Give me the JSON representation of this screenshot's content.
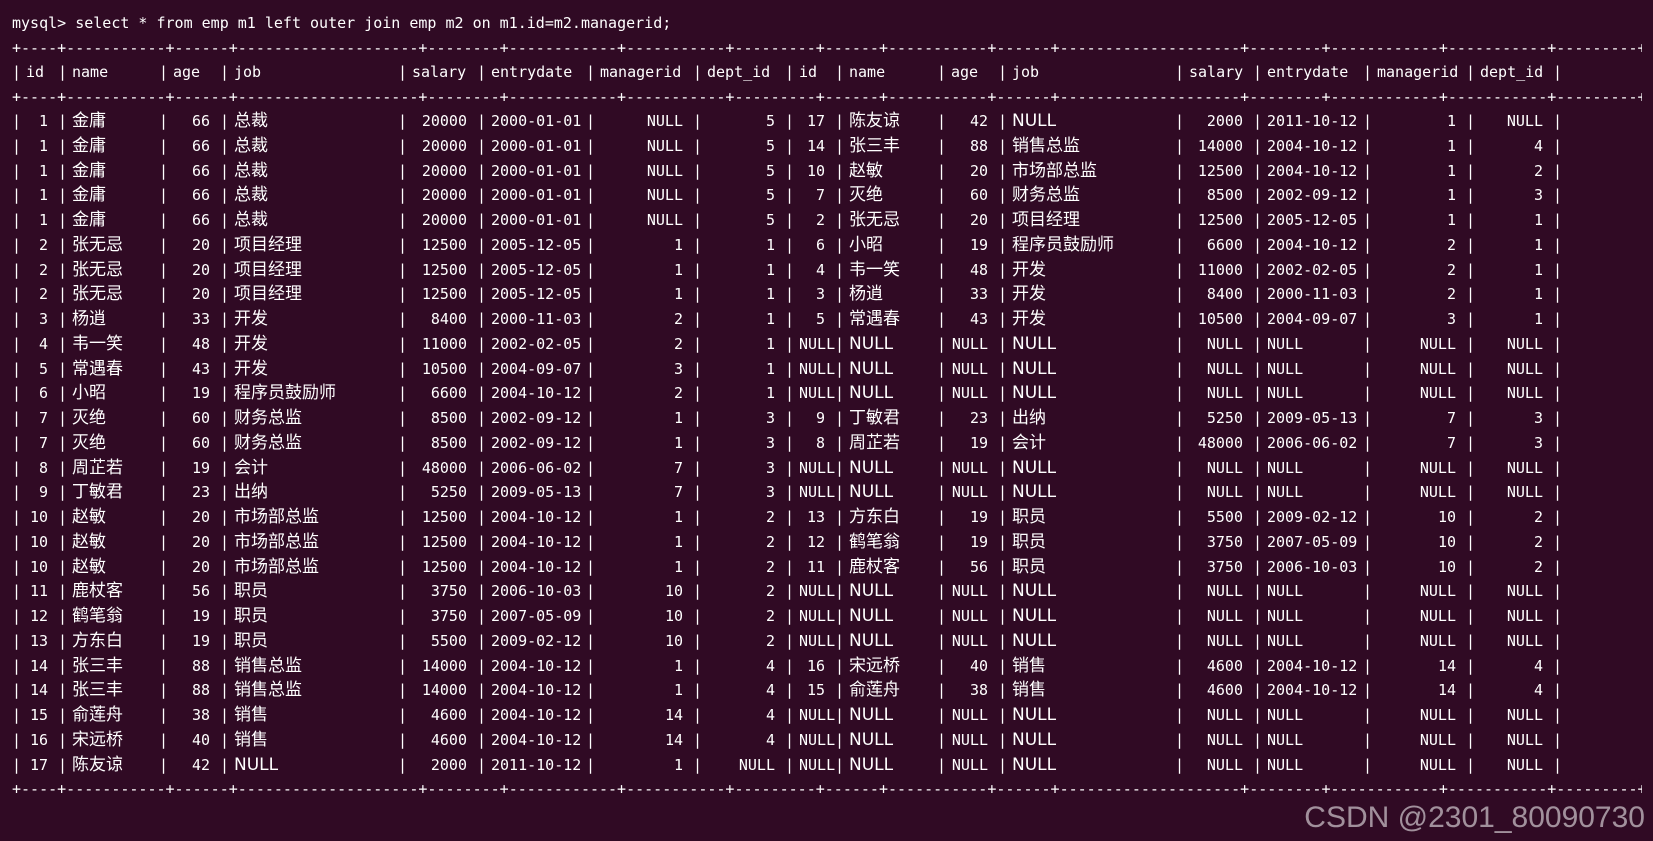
{
  "terminal": {
    "prompt": "mysql>",
    "command": "select * from emp m1 left outer join emp m2 on m1.id=m2.managerid;"
  },
  "table": {
    "separator": "+----+-----------+------+--------------------+--------+------------+-----------+---------+------+-----------+------+--------------------+--------+------------+-----------+---------+",
    "headers": [
      "id",
      "name",
      "age",
      "job",
      "salary",
      "entrydate",
      "managerid",
      "dept_id",
      "id",
      "name",
      "age",
      "job",
      "salary",
      "entrydate",
      "managerid",
      "dept_id"
    ],
    "rows": [
      [
        "1",
        "金庸",
        "66",
        "总裁",
        "20000",
        "2000-01-01",
        "NULL",
        "5",
        "17",
        "陈友谅",
        "42",
        "NULL",
        "2000",
        "2011-10-12",
        "1",
        "NULL"
      ],
      [
        "1",
        "金庸",
        "66",
        "总裁",
        "20000",
        "2000-01-01",
        "NULL",
        "5",
        "14",
        "张三丰",
        "88",
        "销售总监",
        "14000",
        "2004-10-12",
        "1",
        "4"
      ],
      [
        "1",
        "金庸",
        "66",
        "总裁",
        "20000",
        "2000-01-01",
        "NULL",
        "5",
        "10",
        "赵敏",
        "20",
        "市场部总监",
        "12500",
        "2004-10-12",
        "1",
        "2"
      ],
      [
        "1",
        "金庸",
        "66",
        "总裁",
        "20000",
        "2000-01-01",
        "NULL",
        "5",
        "7",
        "灭绝",
        "60",
        "财务总监",
        "8500",
        "2002-09-12",
        "1",
        "3"
      ],
      [
        "1",
        "金庸",
        "66",
        "总裁",
        "20000",
        "2000-01-01",
        "NULL",
        "5",
        "2",
        "张无忌",
        "20",
        "项目经理",
        "12500",
        "2005-12-05",
        "1",
        "1"
      ],
      [
        "2",
        "张无忌",
        "20",
        "项目经理",
        "12500",
        "2005-12-05",
        "1",
        "1",
        "6",
        "小昭",
        "19",
        "程序员鼓励师",
        "6600",
        "2004-10-12",
        "2",
        "1"
      ],
      [
        "2",
        "张无忌",
        "20",
        "项目经理",
        "12500",
        "2005-12-05",
        "1",
        "1",
        "4",
        "韦一笑",
        "48",
        "开发",
        "11000",
        "2002-02-05",
        "2",
        "1"
      ],
      [
        "2",
        "张无忌",
        "20",
        "项目经理",
        "12500",
        "2005-12-05",
        "1",
        "1",
        "3",
        "杨逍",
        "33",
        "开发",
        "8400",
        "2000-11-03",
        "2",
        "1"
      ],
      [
        "3",
        "杨逍",
        "33",
        "开发",
        "8400",
        "2000-11-03",
        "2",
        "1",
        "5",
        "常遇春",
        "43",
        "开发",
        "10500",
        "2004-09-07",
        "3",
        "1"
      ],
      [
        "4",
        "韦一笑",
        "48",
        "开发",
        "11000",
        "2002-02-05",
        "2",
        "1",
        "NULL",
        "NULL",
        "NULL",
        "NULL",
        "NULL",
        "NULL",
        "NULL",
        "NULL"
      ],
      [
        "5",
        "常遇春",
        "43",
        "开发",
        "10500",
        "2004-09-07",
        "3",
        "1",
        "NULL",
        "NULL",
        "NULL",
        "NULL",
        "NULL",
        "NULL",
        "NULL",
        "NULL"
      ],
      [
        "6",
        "小昭",
        "19",
        "程序员鼓励师",
        "6600",
        "2004-10-12",
        "2",
        "1",
        "NULL",
        "NULL",
        "NULL",
        "NULL",
        "NULL",
        "NULL",
        "NULL",
        "NULL"
      ],
      [
        "7",
        "灭绝",
        "60",
        "财务总监",
        "8500",
        "2002-09-12",
        "1",
        "3",
        "9",
        "丁敏君",
        "23",
        "出纳",
        "5250",
        "2009-05-13",
        "7",
        "3"
      ],
      [
        "7",
        "灭绝",
        "60",
        "财务总监",
        "8500",
        "2002-09-12",
        "1",
        "3",
        "8",
        "周芷若",
        "19",
        "会计",
        "48000",
        "2006-06-02",
        "7",
        "3"
      ],
      [
        "8",
        "周芷若",
        "19",
        "会计",
        "48000",
        "2006-06-02",
        "7",
        "3",
        "NULL",
        "NULL",
        "NULL",
        "NULL",
        "NULL",
        "NULL",
        "NULL",
        "NULL"
      ],
      [
        "9",
        "丁敏君",
        "23",
        "出纳",
        "5250",
        "2009-05-13",
        "7",
        "3",
        "NULL",
        "NULL",
        "NULL",
        "NULL",
        "NULL",
        "NULL",
        "NULL",
        "NULL"
      ],
      [
        "10",
        "赵敏",
        "20",
        "市场部总监",
        "12500",
        "2004-10-12",
        "1",
        "2",
        "13",
        "方东白",
        "19",
        "职员",
        "5500",
        "2009-02-12",
        "10",
        "2"
      ],
      [
        "10",
        "赵敏",
        "20",
        "市场部总监",
        "12500",
        "2004-10-12",
        "1",
        "2",
        "12",
        "鹤笔翁",
        "19",
        "职员",
        "3750",
        "2007-05-09",
        "10",
        "2"
      ],
      [
        "10",
        "赵敏",
        "20",
        "市场部总监",
        "12500",
        "2004-10-12",
        "1",
        "2",
        "11",
        "鹿杖客",
        "56",
        "职员",
        "3750",
        "2006-10-03",
        "10",
        "2"
      ],
      [
        "11",
        "鹿杖客",
        "56",
        "职员",
        "3750",
        "2006-10-03",
        "10",
        "2",
        "NULL",
        "NULL",
        "NULL",
        "NULL",
        "NULL",
        "NULL",
        "NULL",
        "NULL"
      ],
      [
        "12",
        "鹤笔翁",
        "19",
        "职员",
        "3750",
        "2007-05-09",
        "10",
        "2",
        "NULL",
        "NULL",
        "NULL",
        "NULL",
        "NULL",
        "NULL",
        "NULL",
        "NULL"
      ],
      [
        "13",
        "方东白",
        "19",
        "职员",
        "5500",
        "2009-02-12",
        "10",
        "2",
        "NULL",
        "NULL",
        "NULL",
        "NULL",
        "NULL",
        "NULL",
        "NULL",
        "NULL"
      ],
      [
        "14",
        "张三丰",
        "88",
        "销售总监",
        "14000",
        "2004-10-12",
        "1",
        "4",
        "16",
        "宋远桥",
        "40",
        "销售",
        "4600",
        "2004-10-12",
        "14",
        "4"
      ],
      [
        "14",
        "张三丰",
        "88",
        "销售总监",
        "14000",
        "2004-10-12",
        "1",
        "4",
        "15",
        "俞莲舟",
        "38",
        "销售",
        "4600",
        "2004-10-12",
        "14",
        "4"
      ],
      [
        "15",
        "俞莲舟",
        "38",
        "销售",
        "4600",
        "2004-10-12",
        "14",
        "4",
        "NULL",
        "NULL",
        "NULL",
        "NULL",
        "NULL",
        "NULL",
        "NULL",
        "NULL"
      ],
      [
        "16",
        "宋远桥",
        "40",
        "销售",
        "4600",
        "2004-10-12",
        "14",
        "4",
        "NULL",
        "NULL",
        "NULL",
        "NULL",
        "NULL",
        "NULL",
        "NULL",
        "NULL"
      ],
      [
        "17",
        "陈友谅",
        "42",
        "NULL",
        "2000",
        "2011-10-12",
        "1",
        "NULL",
        "NULL",
        "NULL",
        "NULL",
        "NULL",
        "NULL",
        "NULL",
        "NULL",
        "NULL"
      ]
    ]
  },
  "watermark": "CSDN @2301_80090730"
}
